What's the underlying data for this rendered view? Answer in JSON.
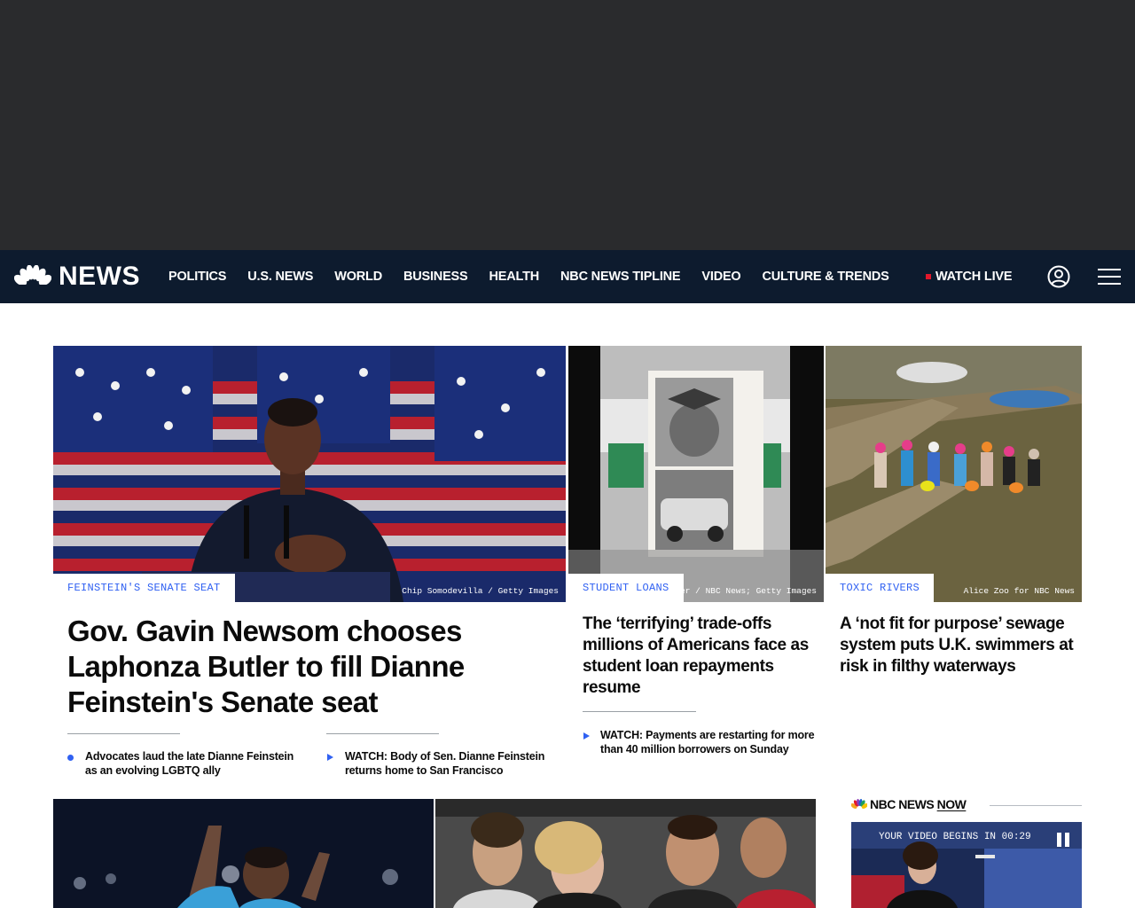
{
  "nav": {
    "logo_text": "NEWS",
    "links": [
      "POLITICS",
      "U.S. NEWS",
      "WORLD",
      "BUSINESS",
      "HEALTH",
      "NBC NEWS TIPLINE",
      "VIDEO",
      "CULTURE & TRENDS"
    ],
    "watch_live": "WATCH LIVE"
  },
  "lead_story": {
    "eyebrow": "FEINSTEIN'S SENATE SEAT",
    "credit": "Chip Somodevilla / Getty Images",
    "headline": "Gov. Gavin Newsom chooses Laphonza Butler to fill Dianne Feinstein's Senate seat",
    "related": [
      {
        "text": "Advocates laud the late Dianne Feinstein as an evolving LGBTQ ally",
        "icon": "dot-icon"
      },
      {
        "text": "WATCH: Body of Sen. Dianne Feinstein returns home to San Francisco",
        "icon": "play-icon"
      }
    ]
  },
  "story_2": {
    "eyebrow": "STUDENT LOANS",
    "credit": "er / NBC News; Getty Images",
    "headline": "The ‘terrifying’ trade-offs millions of Americans face as student loan repayments resume",
    "related": [
      {
        "text": "WATCH: Payments are restarting for more than 40 million borrowers on Sunday",
        "icon": "play-icon"
      }
    ]
  },
  "story_3": {
    "eyebrow": "TOXIC RIVERS",
    "credit": "Alice Zoo for NBC News",
    "headline": "A ‘not fit for purpose’ sewage system puts U.K. swimmers at risk in filthy waterways"
  },
  "nbc_news_now": {
    "brand_a": "NBC NEWS ",
    "brand_b": "NOW",
    "countdown": "YOUR VIDEO BEGINS IN 00:29"
  },
  "colors": {
    "nav_bg": "#0d1b2e",
    "accent_blue": "#3061f2",
    "live_red": "#e2172b"
  }
}
